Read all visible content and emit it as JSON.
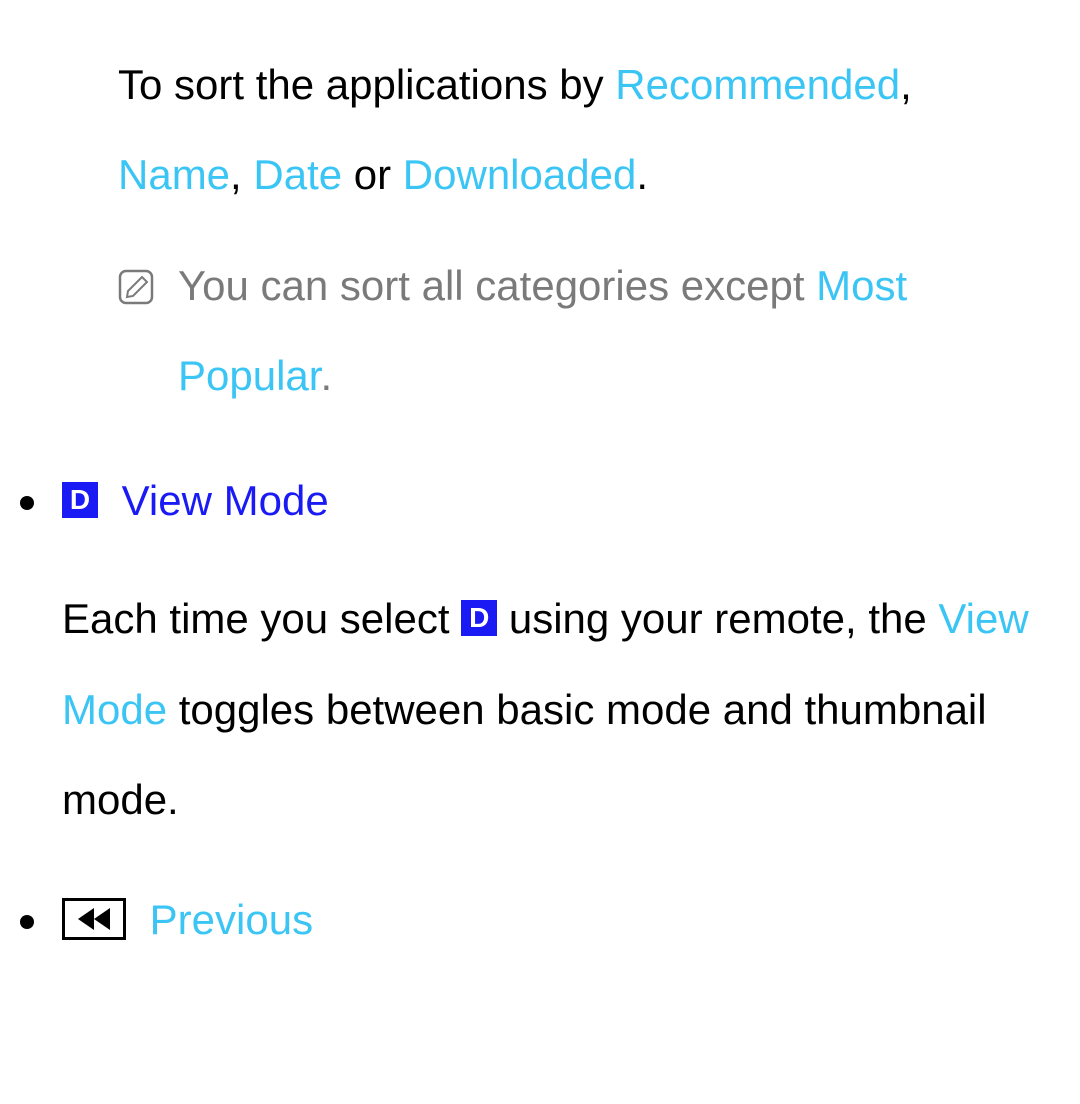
{
  "intro": {
    "text_before": "To sort the applications by ",
    "sort_recommended": "Recommended",
    "sep1": ", ",
    "sort_name": "Name",
    "sep2": ", ",
    "sort_date": "Date",
    "text_or": " or ",
    "sort_downloaded": "Downloaded",
    "period": "."
  },
  "note": {
    "text_before": "You can sort all categories except ",
    "most_popular": "Most Popular",
    "period": "."
  },
  "view_mode": {
    "d_label": "D",
    "title": "View Mode",
    "desc_before": "Each time you select ",
    "desc_mid1": " using your remote, the ",
    "view_mode_inline": "View Mode",
    "desc_after": " toggles between basic mode and thumbnail mode."
  },
  "previous": {
    "title": "Previous"
  }
}
